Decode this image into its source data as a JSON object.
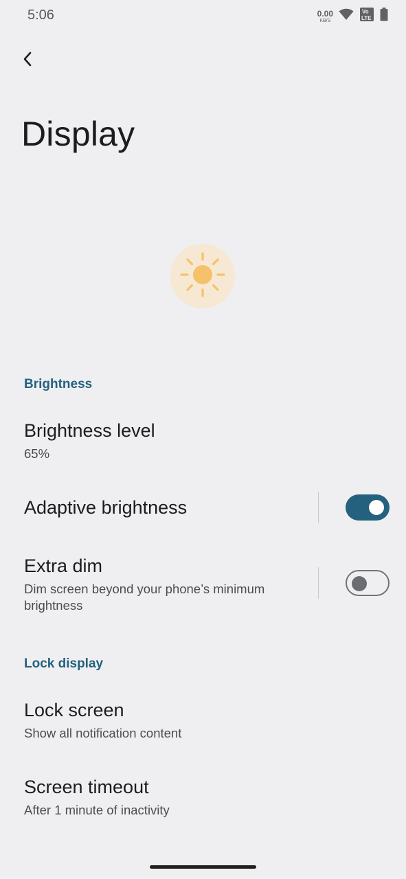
{
  "status_bar": {
    "time": "5:06",
    "net_speed_value": "0.00",
    "net_speed_unit": "KB/S",
    "icons": [
      "wifi-icon",
      "volte-icon",
      "battery-icon"
    ]
  },
  "header": {
    "back_icon": "back-arrow-icon",
    "title": "Display"
  },
  "illustration": {
    "icon": "sun-icon",
    "accent_color": "#f5c26b",
    "background_color": "#f6e8d2"
  },
  "sections": {
    "brightness": {
      "header": "Brightness",
      "brightness_level": {
        "title": "Brightness level",
        "summary": "65%"
      },
      "adaptive_brightness": {
        "title": "Adaptive brightness",
        "enabled": true
      },
      "extra_dim": {
        "title": "Extra dim",
        "summary": "Dim screen beyond your phone’s minimum brightness",
        "enabled": false
      }
    },
    "lock_display": {
      "header": "Lock display",
      "lock_screen": {
        "title": "Lock screen",
        "summary": "Show all notification content"
      },
      "screen_timeout": {
        "title": "Screen timeout",
        "summary": "After 1 minute of inactivity"
      }
    }
  },
  "colors": {
    "accent": "#24617f",
    "background": "#efeff1"
  }
}
